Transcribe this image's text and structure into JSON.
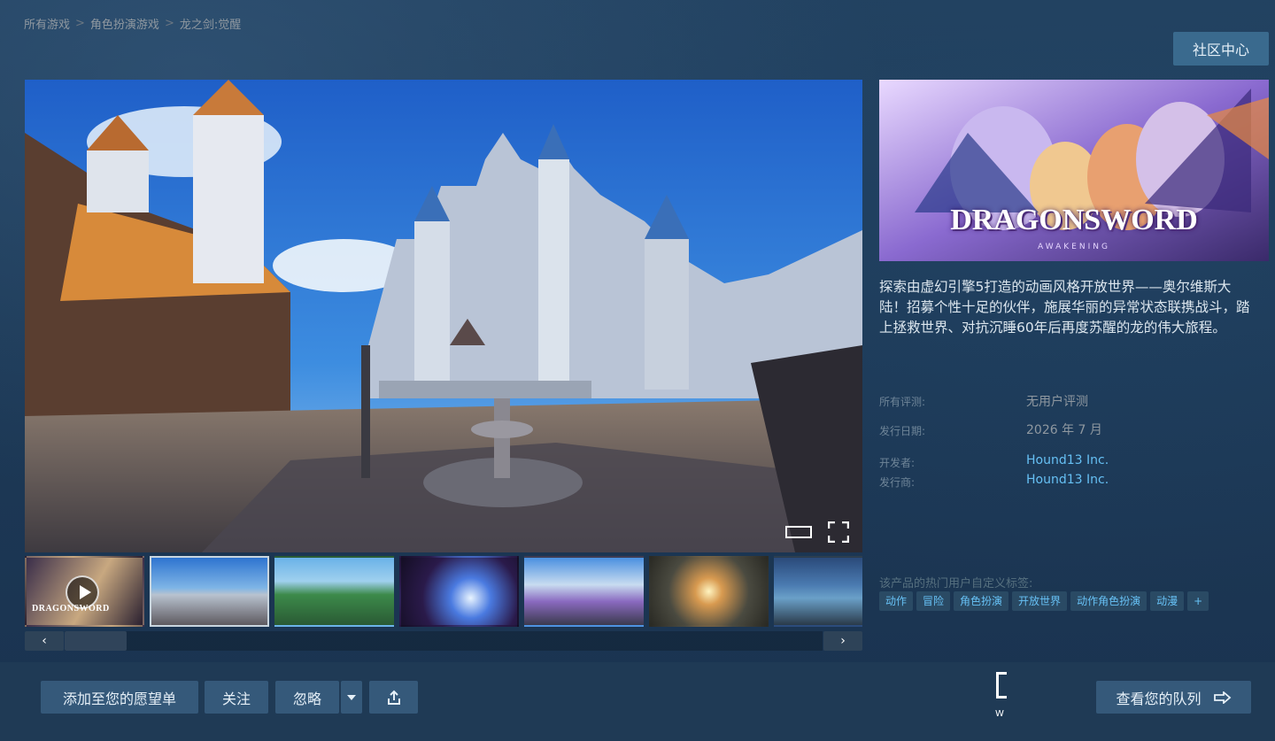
{
  "breadcrumb": {
    "items": [
      "所有游戏",
      "角色扮演游戏",
      "龙之剑:觉醒"
    ],
    "sep": ">"
  },
  "header": {
    "community_hub": "社区中心"
  },
  "media": {
    "thumb_logo": "DRAGONSWORD",
    "prev_arrow": "‹",
    "next_arrow": "›"
  },
  "capsule": {
    "title": "DRAGONSWORD",
    "subtitle": "AWAKENING"
  },
  "description": "探索由虚幻引擎5打造的动画风格开放世界——奥尔维斯大陆！招募个性十足的伙伴，施展华丽的异常状态联携战斗，踏上拯救世界、对抗沉睡60年后再度苏醒的龙的伟大旅程。",
  "meta": {
    "reviews_label": "所有评测:",
    "reviews_value": "无用户评测",
    "release_label": "发行日期:",
    "release_value": "2026 年 7 月",
    "developer_label": "开发者:",
    "developer_value": "Hound13 Inc.",
    "publisher_label": "发行商:",
    "publisher_value": "Hound13 Inc."
  },
  "tags": {
    "label": "该产品的热门用户自定义标签:",
    "items": [
      "动作",
      "冒险",
      "角色扮演",
      "开放世界",
      "动作角色扮演",
      "动漫",
      "+"
    ]
  },
  "actions": {
    "wishlist": "添加至您的愿望单",
    "follow": "关注",
    "ignore": "忽略",
    "queue": "查看您的队列",
    "cursor_text": "W"
  },
  "colors": {
    "accent_link": "#66c0f4",
    "button": "#35597a",
    "tag_bg": "#2a4a64"
  }
}
